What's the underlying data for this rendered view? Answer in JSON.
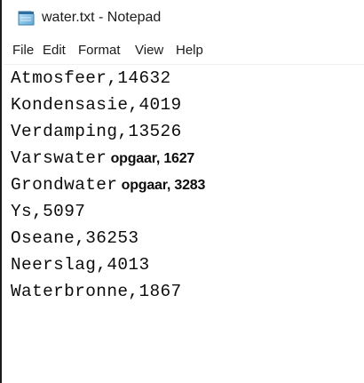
{
  "window": {
    "title": "water.txt - Notepad",
    "icon": "notepad-icon"
  },
  "menu": {
    "items": [
      "File",
      "Edit",
      "Format",
      "View",
      "Help"
    ]
  },
  "editor": {
    "lines": [
      {
        "name": "Atmosfeer",
        "value": "14632"
      },
      {
        "name": "Kondensasie",
        "value": "4019"
      },
      {
        "name": "Verdamping",
        "value": "13526"
      },
      {
        "name": "Varswater",
        "value": " opgaar, 1627"
      },
      {
        "name": "Grondwater",
        "value": " opgaar, 3283"
      },
      {
        "name": "Ys",
        "value": "5097"
      },
      {
        "name": "Oseane",
        "value": "36253"
      },
      {
        "name": "Neerslag",
        "value": "4013"
      },
      {
        "name": "Waterbronne",
        "value": "1867"
      }
    ],
    "separator": ","
  },
  "colors": {
    "background": "#ffffff",
    "text": "#0c0c0c",
    "border": "#1a1a1a"
  }
}
